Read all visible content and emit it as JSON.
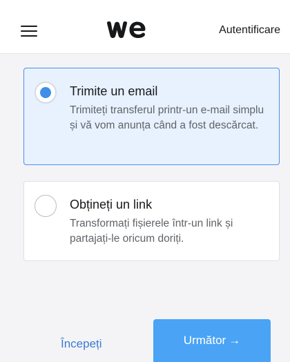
{
  "header": {
    "menu_icon": "hamburger-menu-icon",
    "logo_icon": "wetransfer-logo-icon",
    "login_label": "Autentificare"
  },
  "options": [
    {
      "title": "Trimite un email",
      "description": "Trimiteți transferul printr-un e-mail simplu și vă vom anunța când a fost descărcat.",
      "selected": true
    },
    {
      "title": "Obțineți un link",
      "description": "Transformați fișierele într-un link și partajați-le oricum doriți.",
      "selected": false
    }
  ],
  "footer": {
    "start_label": "Începeți",
    "next_label": "Următor",
    "next_arrow": "→"
  },
  "colors": {
    "accent": "#4aa3f5",
    "radio_selected": "#3f8fe8",
    "selected_card_bg": "#e8f1fe",
    "link": "#3a7bd5"
  }
}
